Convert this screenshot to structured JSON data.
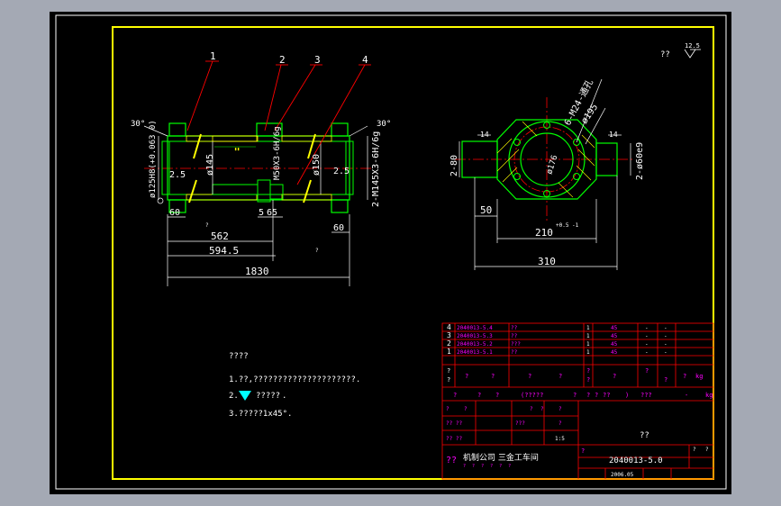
{
  "colors": {
    "background": "#000000",
    "border": "#ffff00",
    "geometry": "#00ff00",
    "dimension": "#ffffff",
    "leader": "#ff0000",
    "hatch": "#ffff00",
    "table_line": "#ff0000",
    "table_text": "#ffffff",
    "table_text_magenta": "#ff00ff"
  },
  "balloons": [
    "1",
    "2",
    "3",
    "4"
  ],
  "angle_labels": [
    "30°",
    "30°"
  ],
  "surface_finish_top": {
    "prefix": "??",
    "value": "12.5"
  },
  "dimensions_front": {
    "d_bore_left": "ø125H8(+0.063 0)",
    "d_inner": "ø145",
    "d_inner_right": "ø150",
    "thread_mid": "M50X3-6H/6g",
    "thread_right": "2-M145X3-6H/6g",
    "wall_left": "2.5",
    "wall_right": "2.5",
    "len_60_left": "60",
    "len_65": "65",
    "len_5": "5",
    "len_60_right": "60",
    "len_562": "562",
    "len_594_5": "594.5",
    "len_1830": "1830",
    "note_small_1": "?",
    "note_small_2": "?"
  },
  "dimensions_side": {
    "holes": "6-M24-通孔",
    "d_195": "ø195",
    "d_176": "ø176",
    "len_2_80": "2-80",
    "len_14": "14",
    "len_50": "50",
    "len_210": "210",
    "tol_210": "+0.5 -1",
    "len_310": "310",
    "d_60e9": "2-ø60e9",
    "len_14b": "14"
  },
  "notes": {
    "title": "????",
    "line1": "1.??,?????????????????????.",
    "line2_prefix": "2.",
    "line2_text": "?????",
    "line2_suffix": ".",
    "line3": "3.?????1x45°."
  },
  "title_block": {
    "parts": [
      {
        "no": "4",
        "code": "2040013-5.4",
        "name": "??",
        "qty": "1",
        "material": "45"
      },
      {
        "no": "3",
        "code": "2040013-5.3",
        "name": "??",
        "qty": "1",
        "material": "45"
      },
      {
        "no": "2",
        "code": "2040013-5.2",
        "name": "???",
        "qty": "1",
        "material": "45"
      },
      {
        "no": "1",
        "code": "2040013-5.1",
        "name": "??",
        "qty": "1",
        "material": "45"
      }
    ],
    "dash": "-",
    "header_row": [
      "?",
      "?",
      "?",
      "?",
      "?",
      "?",
      "?",
      "?",
      "?",
      "?",
      "?",
      "?"
    ],
    "header_kg": "kg",
    "row2": [
      "?",
      "?",
      "?",
      "(?????",
      "?",
      "?",
      "?",
      "??",
      ")",
      "???",
      "-",
      "kg"
    ],
    "row3": [
      "?",
      "?",
      "?",
      "?",
      "?"
    ],
    "row4": [
      "?? ??",
      "???",
      "?"
    ],
    "row5": [
      "?? ??",
      "1:5"
    ],
    "drawing_name": "??",
    "company": "机制公司 三金工车间",
    "company_prefix": "??",
    "drawing_no": "2040013-5.0",
    "drawing_no_prefix": "?",
    "date": "2006.05",
    "sheet": [
      "?",
      "?"
    ],
    "bottom_marks": [
      "?",
      "?",
      "?",
      "?",
      "?",
      "?"
    ]
  }
}
